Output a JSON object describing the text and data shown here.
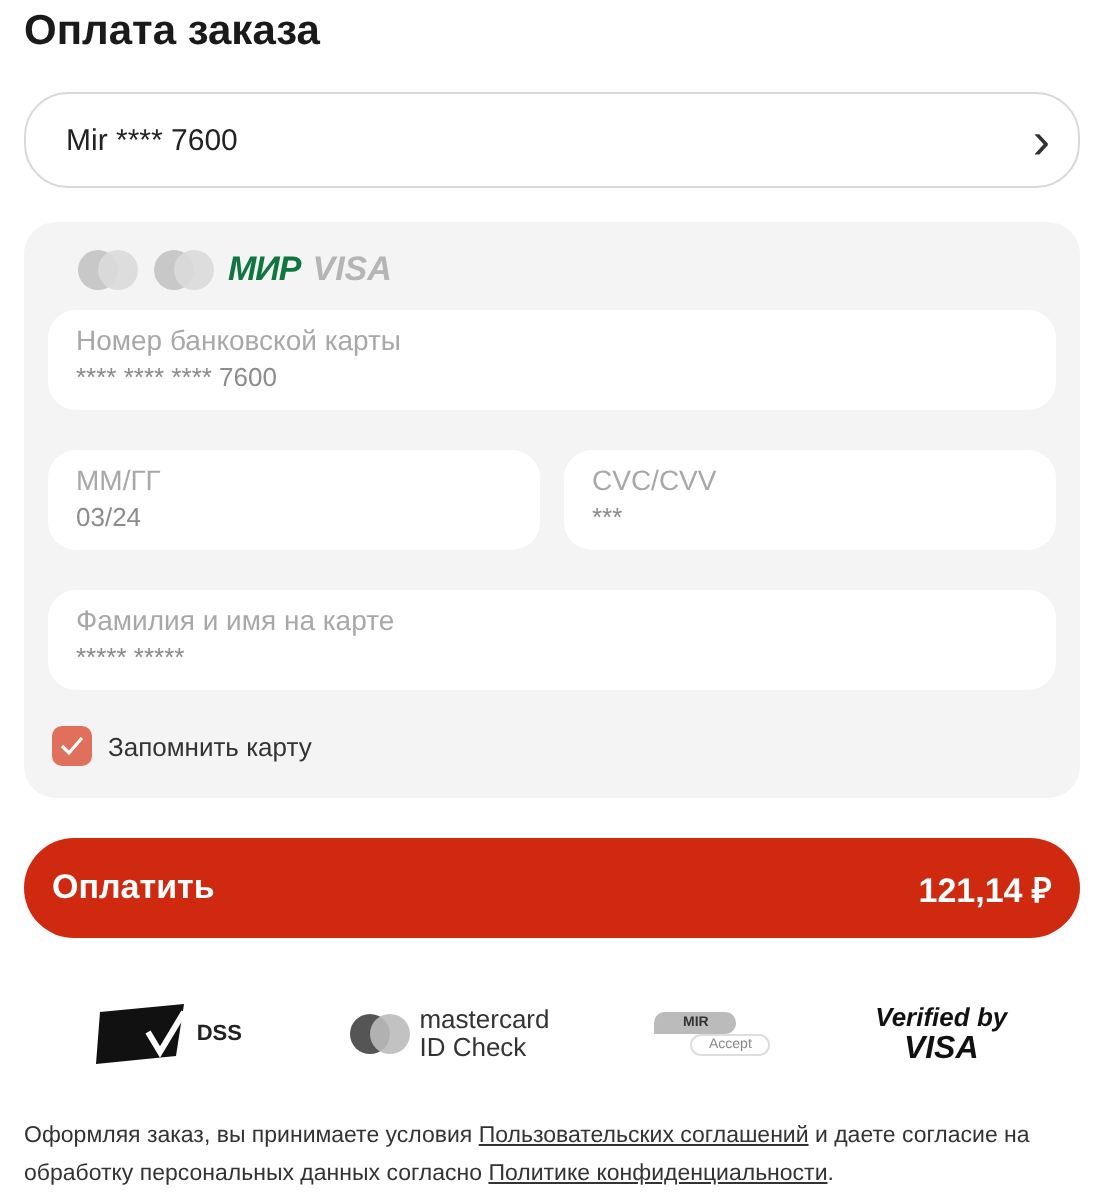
{
  "title": "Оплата заказа",
  "card_select": {
    "value": "Mir **** 7600",
    "chevron": "›"
  },
  "card_brands": [
    {
      "kind": "mastercard"
    },
    {
      "kind": "maestro"
    },
    {
      "kind": "mir",
      "label": "МИР"
    },
    {
      "kind": "visa",
      "label": "VISA"
    }
  ],
  "fields": [
    {
      "label": "Номер банковской карты",
      "value": "**** **** **** 7600",
      "wide": true
    },
    {
      "label": "ММ/ГГ",
      "value": "03/24",
      "wide": false
    },
    {
      "label": "CVC/CVV",
      "value": "***",
      "wide": false
    },
    {
      "label": "Фамилия и имя на карте",
      "value": "***** *****",
      "wide": true
    }
  ],
  "remember": {
    "label": "Запомнить карту",
    "checked": true
  },
  "pay_button": {
    "label": "Оплатить",
    "amount": "121,14 ₽"
  },
  "security_logos": [
    {
      "kind": "pci",
      "text": "DSS"
    },
    {
      "kind": "mc_id",
      "text": "mastercard",
      "text2": "ID Check"
    },
    {
      "kind": "mir_accept",
      "text": "MIR",
      "text2": "Accept"
    },
    {
      "kind": "verified_visa",
      "text": "Verified by",
      "text2": "VISA"
    }
  ],
  "footer": {
    "parts": [
      {
        "kind": "text",
        "text": "Оформляя заказ, вы принимаете условия "
      },
      {
        "kind": "link",
        "text": "Пользовательских соглашений"
      },
      {
        "kind": "text",
        "text": " и даете согласие на обработку персональных данных согласно "
      },
      {
        "kind": "link",
        "text": "Политике конфиденциальности"
      },
      {
        "kind": "text",
        "text": "."
      }
    ]
  }
}
